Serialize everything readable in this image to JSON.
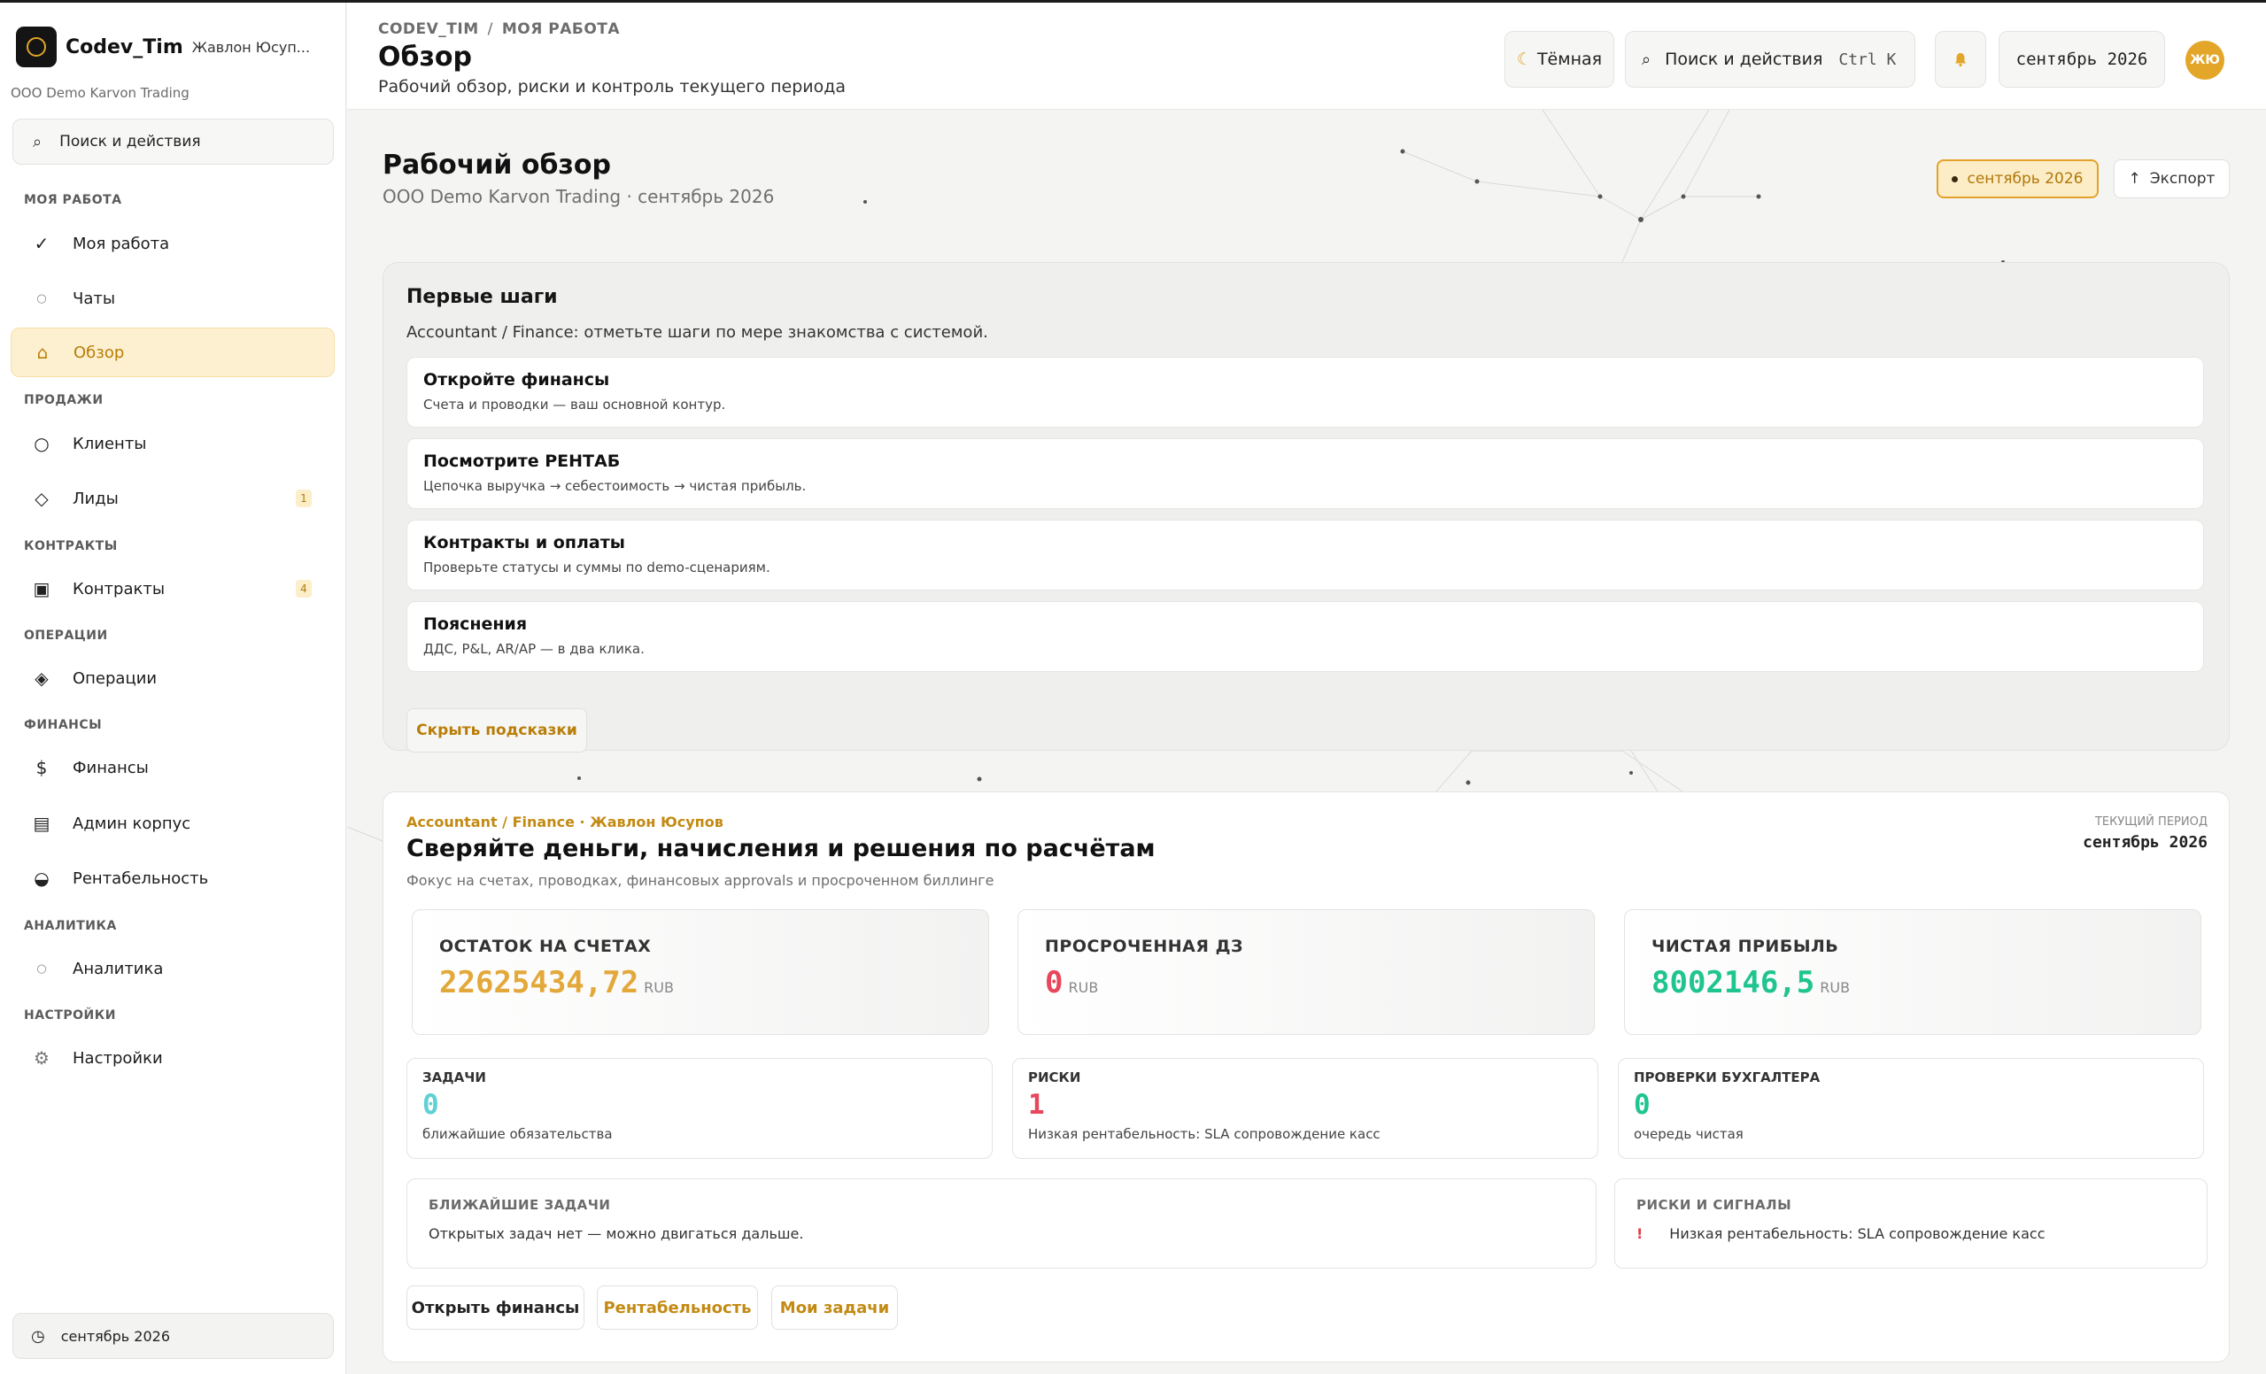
{
  "sidebar": {
    "brand": {
      "name": "Codev_Tim",
      "user": "Жавлон Юсуп..."
    },
    "org": "ООО Demo Karvon Trading",
    "search_label": "Поиск и действия",
    "sections": {
      "my_work": "МОЯ РАБОТА",
      "sales": "ПРОДАЖИ",
      "contracts": "КОНТРАКТЫ",
      "operations": "ОПЕРАЦИИ",
      "finance": "ФИНАНСЫ",
      "analytics": "АНАЛИТИКА",
      "settings": "НАСТРОЙКИ"
    },
    "items": {
      "my_work": {
        "label": "Моя работа",
        "icon": "check-icon"
      },
      "chats": {
        "label": "Чаты",
        "icon": "circle-small-icon"
      },
      "overview": {
        "label": "Обзор",
        "icon": "home-icon"
      },
      "clients": {
        "label": "Клиенты",
        "icon": "circle-icon"
      },
      "leads": {
        "label": "Лиды",
        "icon": "diamond-icon",
        "badge": "1"
      },
      "contracts": {
        "label": "Контракты",
        "icon": "square-icon",
        "badge": "4"
      },
      "operations": {
        "label": "Операции",
        "icon": "diamond-dot-icon"
      },
      "finance": {
        "label": "Финансы",
        "icon": "dollar-icon"
      },
      "admin": {
        "label": "Админ корпус",
        "icon": "list-icon"
      },
      "profitability": {
        "label": "Рентабельность",
        "icon": "half-circle-icon"
      },
      "analytics": {
        "label": "Аналитика",
        "icon": "circle-small-icon"
      },
      "settings": {
        "label": "Настройки",
        "icon": "gear-icon"
      }
    },
    "period_label": "сентябрь 2026"
  },
  "header": {
    "breadcrumb_root": "CODEV_TIM",
    "breadcrumb_sep": "/",
    "breadcrumb_current": "МОЯ РАБОТА",
    "title": "Обзор",
    "subtitle": "Рабочий обзор, риски и контроль текущего периода",
    "theme_label": "Тёмная",
    "search_label": "Поиск и действия",
    "search_shortcut": "Ctrl K",
    "period": "сентябрь 2026",
    "avatar_initials": "ЖЮ"
  },
  "overview": {
    "title": "Рабочий обзор",
    "subtitle": "ООО Demo Karvon Trading · сентябрь 2026",
    "period_pill": "сентябрь 2026",
    "export_label": "Экспорт"
  },
  "first_steps": {
    "title": "Первые шаги",
    "subtitle": "Accountant / Finance: отметьте шаги по мере знакомства с системой.",
    "steps": [
      {
        "title": "Откройте финансы",
        "desc": "Счета и проводки — ваш основной контур."
      },
      {
        "title": "Посмотрите РЕНТАБ",
        "desc": "Цепочка выручка → себестоимость → чистая прибыль."
      },
      {
        "title": "Контракты и оплаты",
        "desc": "Проверьте статусы и суммы по demo-сценариям."
      },
      {
        "title": "Пояснения",
        "desc": "ДДС, P&L, AR/AP — в два клика."
      }
    ],
    "hide_label": "Скрыть подсказки"
  },
  "focus": {
    "kicker": "Accountant / Finance · Жавлон Юсупов",
    "title": "Сверяйте деньги, начисления и решения по расчётам",
    "subtitle": "Фокус на счетах, проводках, финансовых approvals и просроченном биллинге",
    "current_period_label": "ТЕКУЩИЙ ПЕРИОД",
    "current_period": "сентябрь 2026",
    "kpis": [
      {
        "label": "ОСТАТОК НА СЧЕТАХ",
        "value": "22625434,72",
        "unit": "RUB",
        "color": "#e3a83a"
      },
      {
        "label": "ПРОСРОЧЕННАЯ ДЗ",
        "value": "0",
        "unit": "RUB",
        "color": "#e8465c"
      },
      {
        "label": "ЧИСТАЯ ПРИБЫЛЬ",
        "value": "8002146,5",
        "unit": "RUB",
        "color": "#1fc48f"
      }
    ],
    "minis": [
      {
        "label": "ЗАДАЧИ",
        "value": "0",
        "note": "ближайшие обязательства",
        "color": "#5fd0d3"
      },
      {
        "label": "РИСКИ",
        "value": "1",
        "note": "Низкая рентабельность: SLA сопровождение касс",
        "color": "#e8465c"
      },
      {
        "label": "ПРОВЕРКИ БУХГАЛТЕРА",
        "value": "0",
        "note": "очередь чистая",
        "color": "#1fc48f"
      }
    ],
    "tasks_box": {
      "label": "БЛИЖАЙШИЕ ЗАДАЧИ",
      "text": "Открытых задач нет — можно двигаться дальше."
    },
    "risks_box": {
      "label": "РИСКИ И СИГНАЛЫ",
      "marker": "!",
      "text": "Низкая рентабельность: SLA сопровождение касс"
    },
    "actions": {
      "open_finance": "Открыть финансы",
      "profitability": "Рентабельность",
      "my_tasks": "Мои задачи"
    }
  }
}
